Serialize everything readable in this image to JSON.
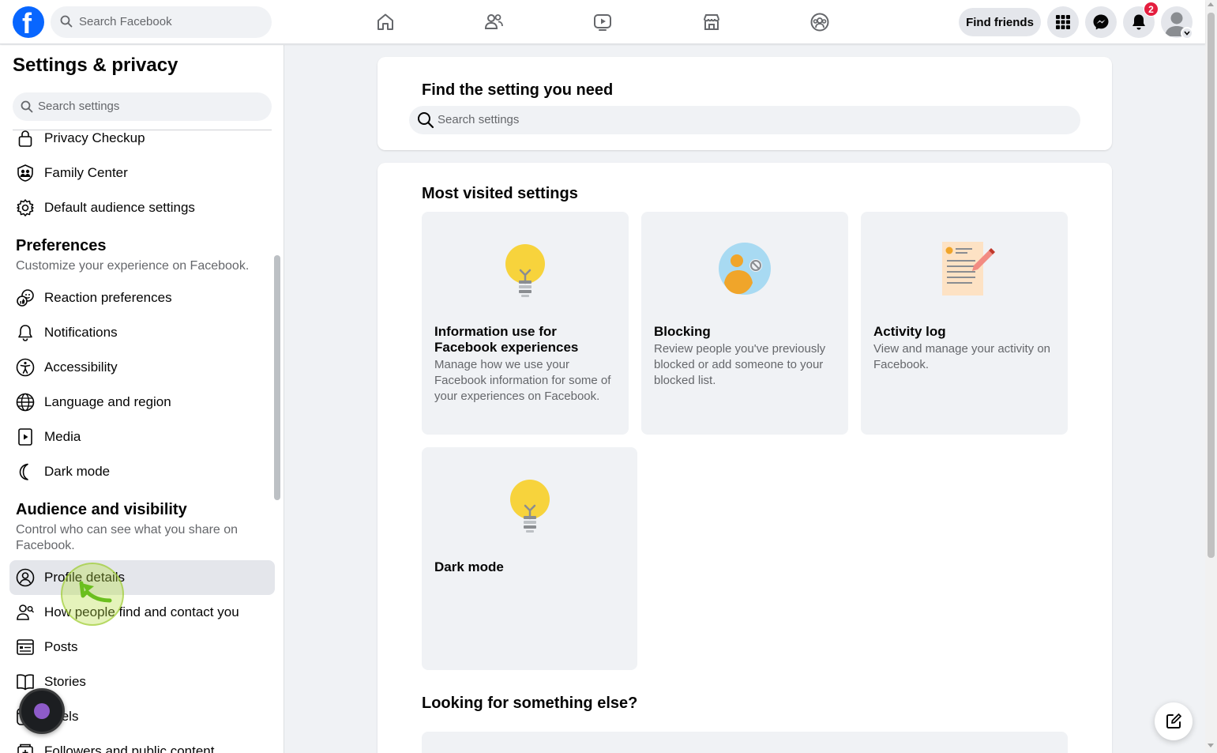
{
  "topbar": {
    "logo_letter": "f",
    "search_placeholder": "Search Facebook",
    "nav_icons": [
      "home-icon",
      "friends-icon",
      "watch-icon",
      "marketplace-icon",
      "groups-icon"
    ],
    "find_friends_label": "Find friends",
    "notification_count": "2"
  },
  "sidebar": {
    "title": "Settings & privacy",
    "search_placeholder": "Search settings",
    "top_items": [
      {
        "label": "Privacy Checkup",
        "icon": "lock-icon"
      },
      {
        "label": "Family Center",
        "icon": "family-icon"
      },
      {
        "label": "Default audience settings",
        "icon": "gear-icon"
      }
    ],
    "preferences": {
      "title": "Preferences",
      "subtitle": "Customize your experience on Facebook.",
      "items": [
        {
          "label": "Reaction preferences",
          "icon": "reaction-icon"
        },
        {
          "label": "Notifications",
          "icon": "bell-icon"
        },
        {
          "label": "Accessibility",
          "icon": "accessibility-icon"
        },
        {
          "label": "Language and region",
          "icon": "globe-icon"
        },
        {
          "label": "Media",
          "icon": "media-icon"
        },
        {
          "label": "Dark mode",
          "icon": "moon-icon"
        }
      ]
    },
    "audience": {
      "title": "Audience and visibility",
      "subtitle": "Control who can see what you share on Facebook.",
      "items": [
        {
          "label": "Profile details",
          "icon": "profile-icon"
        },
        {
          "label": "How people find and contact you",
          "icon": "person-add-icon"
        },
        {
          "label": "Posts",
          "icon": "posts-icon"
        },
        {
          "label": "Stories",
          "icon": "book-icon"
        },
        {
          "label": "Reels",
          "icon": "reels-icon"
        },
        {
          "label": "Followers and public content",
          "icon": "followers-icon"
        }
      ]
    }
  },
  "main": {
    "find_title": "Find the setting you need",
    "search_placeholder": "Search settings",
    "most_visited_title": "Most visited settings",
    "tiles": [
      {
        "title": "Information use for Facebook experiences",
        "desc": "Manage how we use your Facebook information for some of your experiences on Facebook.",
        "icon": "lightbulb-icon"
      },
      {
        "title": "Blocking",
        "desc": "Review people you've previously blocked or add someone to your blocked list.",
        "icon": "blocked-person-icon"
      },
      {
        "title": "Activity log",
        "desc": "View and manage your activity on Facebook.",
        "icon": "activity-log-icon"
      },
      {
        "title": "Dark mode",
        "desc": "",
        "icon": "lightbulb-icon"
      }
    ],
    "looking_title": "Looking for something else?"
  },
  "colors": {
    "brand": "#0866ff",
    "background": "#f0f2f5",
    "badge": "#e41e3f",
    "bulb": "#f7d33c"
  }
}
